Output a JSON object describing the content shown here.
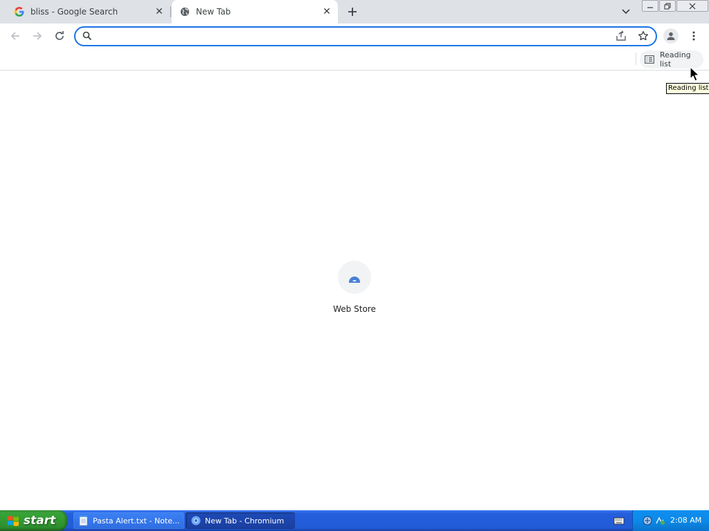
{
  "tabs": [
    {
      "title": "bliss - Google Search",
      "favicon": "google-g-icon",
      "active": false
    },
    {
      "title": "New Tab",
      "favicon": "globe-icon",
      "active": true
    }
  ],
  "omnibox": {
    "value": "",
    "placeholder": ""
  },
  "bookmarks_bar": {
    "reading_list_label": "Reading list"
  },
  "tooltip": {
    "text": "Reading list"
  },
  "shortcuts": [
    {
      "label": "Web Store",
      "icon": "web-store-icon"
    }
  ],
  "taskbar": {
    "start_label": "start",
    "tasks": [
      {
        "label": "Pasta Alert.txt - Note...",
        "icon": "notepad-icon"
      },
      {
        "label": "New Tab - Chromium",
        "icon": "chromium-icon"
      }
    ],
    "clock": "2:08 AM"
  },
  "colors": {
    "accent": "#1a73e8",
    "tabstrip": "#dee1e6",
    "taskbar": "#245edb",
    "start": "#36a336"
  }
}
